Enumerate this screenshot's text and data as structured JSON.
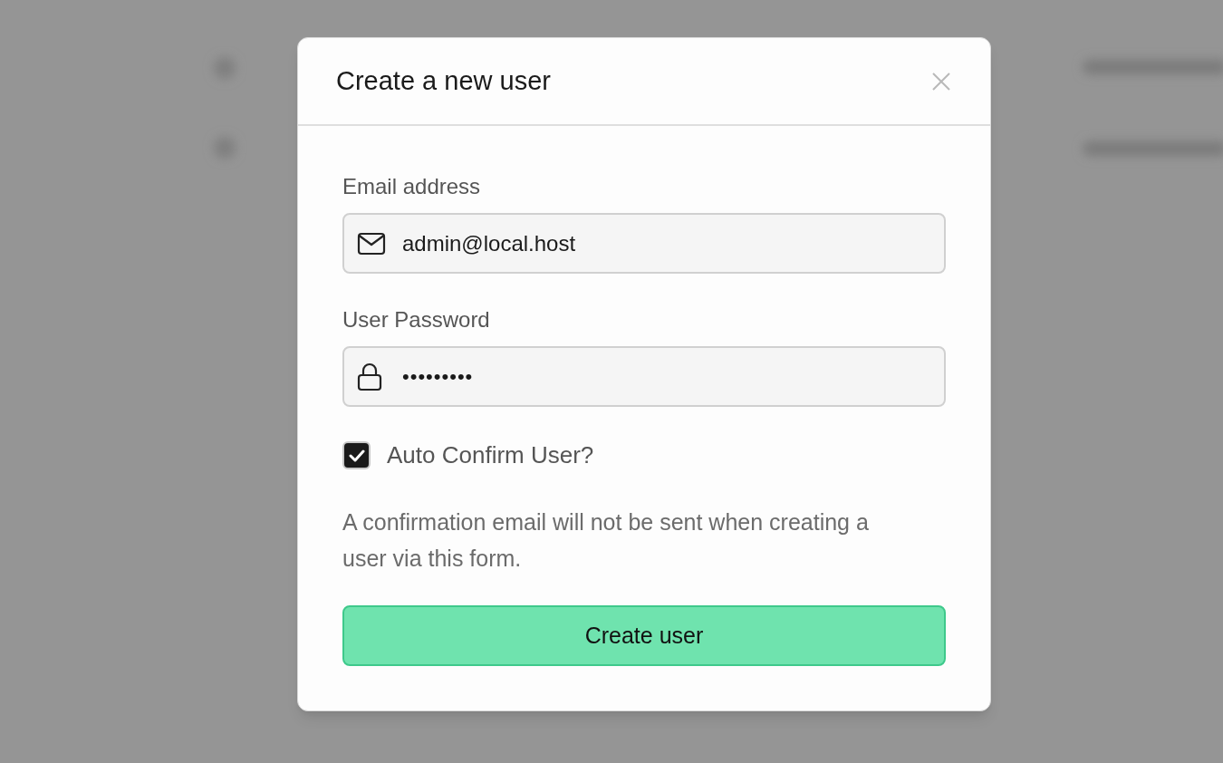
{
  "dialog": {
    "title": "Create a new user",
    "fields": [
      {
        "label": "Email address",
        "kind": "email",
        "value": "admin@local.host"
      },
      {
        "label": "User Password",
        "kind": "password",
        "value": "•••••••••"
      }
    ],
    "checkbox": {
      "label": "Auto Confirm User?",
      "checked": true
    },
    "note": "A confirmation email will not be sent when creating a user via this form.",
    "submit": "Create user"
  }
}
